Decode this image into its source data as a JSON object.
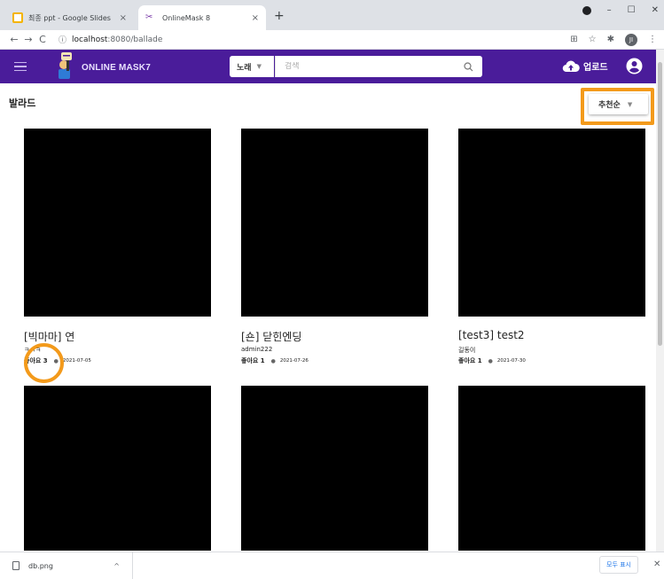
{
  "browser": {
    "tabs": [
      {
        "title": "최종 ppt - Google Slides",
        "close": "×"
      },
      {
        "title": "OnlineMask 8",
        "close": "×"
      }
    ],
    "new_tab": "+",
    "window_controls": {
      "minimize": "–",
      "maximize": "☐",
      "close": "✕"
    },
    "nav": {
      "back": "←",
      "forward": "→",
      "reload": "C"
    },
    "url": {
      "info": "ⓘ",
      "host": "localhost",
      "path": ":8080/ballade"
    },
    "profile_initial": "JI"
  },
  "app": {
    "brand": "ONLINE MASK7",
    "search": {
      "category": "노래",
      "placeholder": "검색"
    },
    "upload_label": "업로드",
    "accent": "#4a1c9a"
  },
  "page": {
    "title": "발라드",
    "sort": "추천순",
    "highlight_color": "#f39a1b"
  },
  "cards": [
    {
      "title": "[빅마마] 연",
      "author": "ㅋㅋㅋ",
      "likes": "좋아요 3",
      "date": "2021-07-05"
    },
    {
      "title": "[숀] 닫힌엔딩",
      "author": "admin222",
      "likes": "좋아요 1",
      "date": "2021-07-26"
    },
    {
      "title": "[test3] test2",
      "author": "길동이",
      "likes": "좋아요 1",
      "date": "2021-07-30"
    }
  ],
  "downloads": {
    "file": "db.png",
    "chevron": "^",
    "show_all": "모두 표시",
    "close": "✕"
  }
}
